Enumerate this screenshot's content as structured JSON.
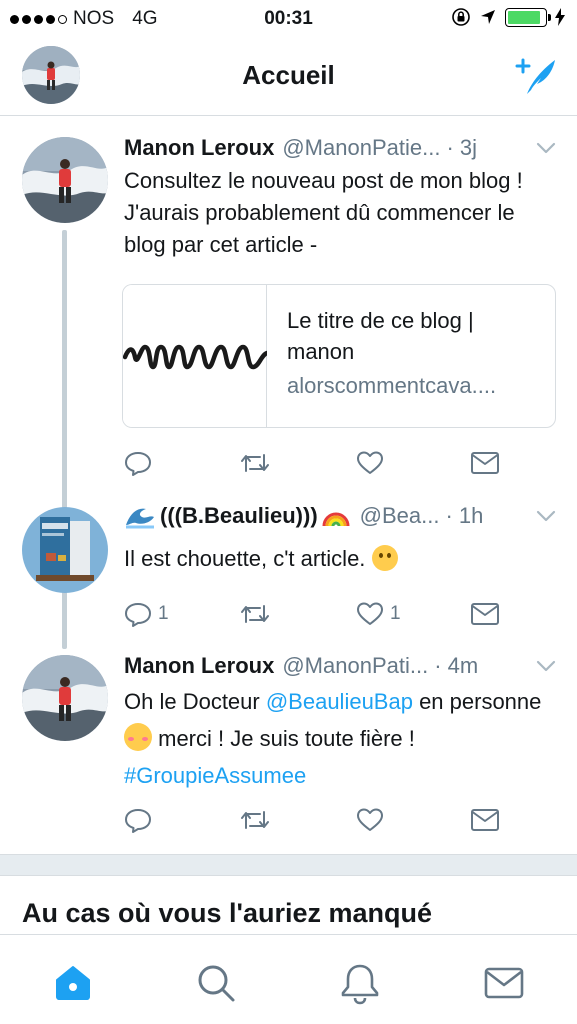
{
  "status_bar": {
    "carrier": "NOS",
    "network": "4G",
    "time": "00:31",
    "battery_level": 0.9,
    "battery_color": "#4cd964"
  },
  "header": {
    "title": "Accueil",
    "compose_icon": "compose-tweet-icon",
    "accent_color": "#1da1f2"
  },
  "tweets": [
    {
      "name": "Manon Leroux",
      "handle": "@ManonPatie...",
      "time": "· 3j",
      "text": "Consultez le nouveau post de mon blog ! J'aurais probablement dû commencer le blog par cet article -",
      "card": {
        "title": "Le titre de ce blog | manon",
        "domain": "alorscommentcava...."
      },
      "reply_count": "",
      "retweet_count": "",
      "like_count": ""
    },
    {
      "name": "(((B.Beaulieu)))",
      "handle": "@Bea...",
      "time": "· 1h",
      "text": "Il est chouette, c't article. ",
      "reply_count": "1",
      "retweet_count": "",
      "like_count": "1"
    },
    {
      "name": "Manon Leroux",
      "handle": "@ManonPati...",
      "time": "· 4m",
      "text_part1": "Oh le Docteur ",
      "mention": "@BeaulieuBap",
      "text_part2": " en personne ",
      "text_part3": "merci ! Je suis toute fière ! ",
      "hashtag": "#GroupieAssumee",
      "reply_count": "",
      "retweet_count": "",
      "like_count": ""
    }
  ],
  "section_title": "Au cas où vous l'auriez manqué",
  "tabbar": {
    "items": [
      "home-icon",
      "search-icon",
      "notifications-icon",
      "messages-icon"
    ],
    "active": "home-icon"
  }
}
